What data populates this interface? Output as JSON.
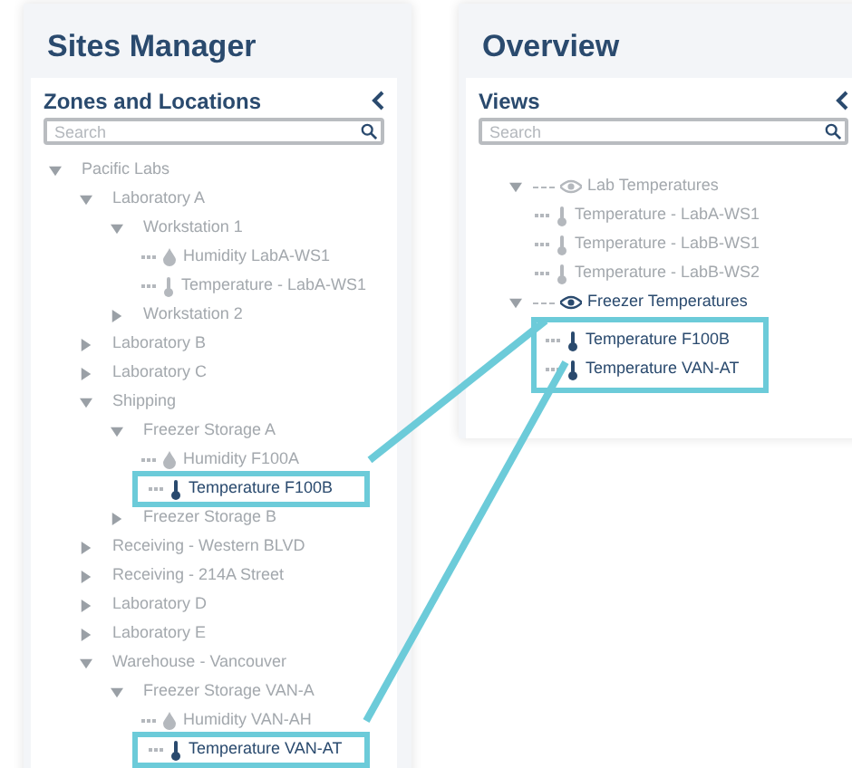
{
  "sites_manager": {
    "title": "Sites Manager",
    "panel": {
      "title": "Zones and Locations",
      "search": {
        "placeholder": "Search"
      },
      "tree": [
        {
          "label": "Pacific Labs",
          "kind": "group",
          "expanded": true,
          "active": false,
          "children": [
            {
              "label": "Laboratory A",
              "kind": "group",
              "expanded": true,
              "active": false,
              "children": [
                {
                  "label": "Workstation 1",
                  "kind": "group",
                  "expanded": true,
                  "active": false,
                  "children": [
                    {
                      "label": "Humidity LabA-WS1",
                      "kind": "humidity",
                      "active": false,
                      "highlighted": false
                    },
                    {
                      "label": "Temperature - LabA-WS1",
                      "kind": "temperature",
                      "active": false,
                      "highlighted": false
                    }
                  ]
                },
                {
                  "label": "Workstation 2",
                  "kind": "group",
                  "expanded": false,
                  "active": false
                }
              ]
            },
            {
              "label": "Laboratory B",
              "kind": "group",
              "expanded": false,
              "active": false
            },
            {
              "label": "Laboratory C",
              "kind": "group",
              "expanded": false,
              "active": false
            },
            {
              "label": "Shipping",
              "kind": "group",
              "expanded": true,
              "active": false,
              "children": [
                {
                  "label": "Freezer Storage A",
                  "kind": "group",
                  "expanded": true,
                  "active": false,
                  "children": [
                    {
                      "label": "Humidity F100A",
                      "kind": "humidity",
                      "active": false,
                      "highlighted": false
                    },
                    {
                      "label": "Temperature F100B",
                      "kind": "temperature",
                      "active": true,
                      "highlighted": true
                    }
                  ]
                },
                {
                  "label": "Freezer Storage B",
                  "kind": "group",
                  "expanded": false,
                  "active": false
                }
              ]
            },
            {
              "label": "Receiving - Western BLVD",
              "kind": "group",
              "expanded": false,
              "active": false
            },
            {
              "label": "Receiving - 214A Street",
              "kind": "group",
              "expanded": false,
              "active": false
            },
            {
              "label": "Laboratory D",
              "kind": "group",
              "expanded": false,
              "active": false
            },
            {
              "label": "Laboratory E",
              "kind": "group",
              "expanded": false,
              "active": false
            },
            {
              "label": "Warehouse - Vancouver",
              "kind": "group",
              "expanded": true,
              "active": false,
              "children": [
                {
                  "label": "Freezer Storage VAN-A",
                  "kind": "group",
                  "expanded": true,
                  "active": false,
                  "children": [
                    {
                      "label": "Humidity VAN-AH",
                      "kind": "humidity",
                      "active": false,
                      "highlighted": false
                    },
                    {
                      "label": "Temperature VAN-AT",
                      "kind": "temperature",
                      "active": true,
                      "highlighted": true
                    }
                  ]
                }
              ]
            }
          ]
        }
      ]
    }
  },
  "overview": {
    "title": "Overview",
    "panel": {
      "title": "Views",
      "search": {
        "placeholder": "Search"
      },
      "tree": [
        {
          "label": "Lab Temperatures",
          "kind": "view",
          "expanded": true,
          "active": false,
          "highlighted": false,
          "children": [
            {
              "label": "Temperature - LabA-WS1",
              "kind": "temperature",
              "active": false,
              "highlighted": false
            },
            {
              "label": "Temperature - LabB-WS1",
              "kind": "temperature",
              "active": false,
              "highlighted": false
            },
            {
              "label": "Temperature - LabB-WS2",
              "kind": "temperature",
              "active": false,
              "highlighted": false
            }
          ]
        },
        {
          "label": "Freezer Temperatures",
          "kind": "view",
          "expanded": true,
          "active": true,
          "highlighted": true,
          "children": [
            {
              "label": "Temperature F100B",
              "kind": "temperature",
              "active": true,
              "highlighted": false
            },
            {
              "label": "Temperature VAN-AT",
              "kind": "temperature",
              "active": true,
              "highlighted": false
            }
          ]
        }
      ]
    }
  }
}
